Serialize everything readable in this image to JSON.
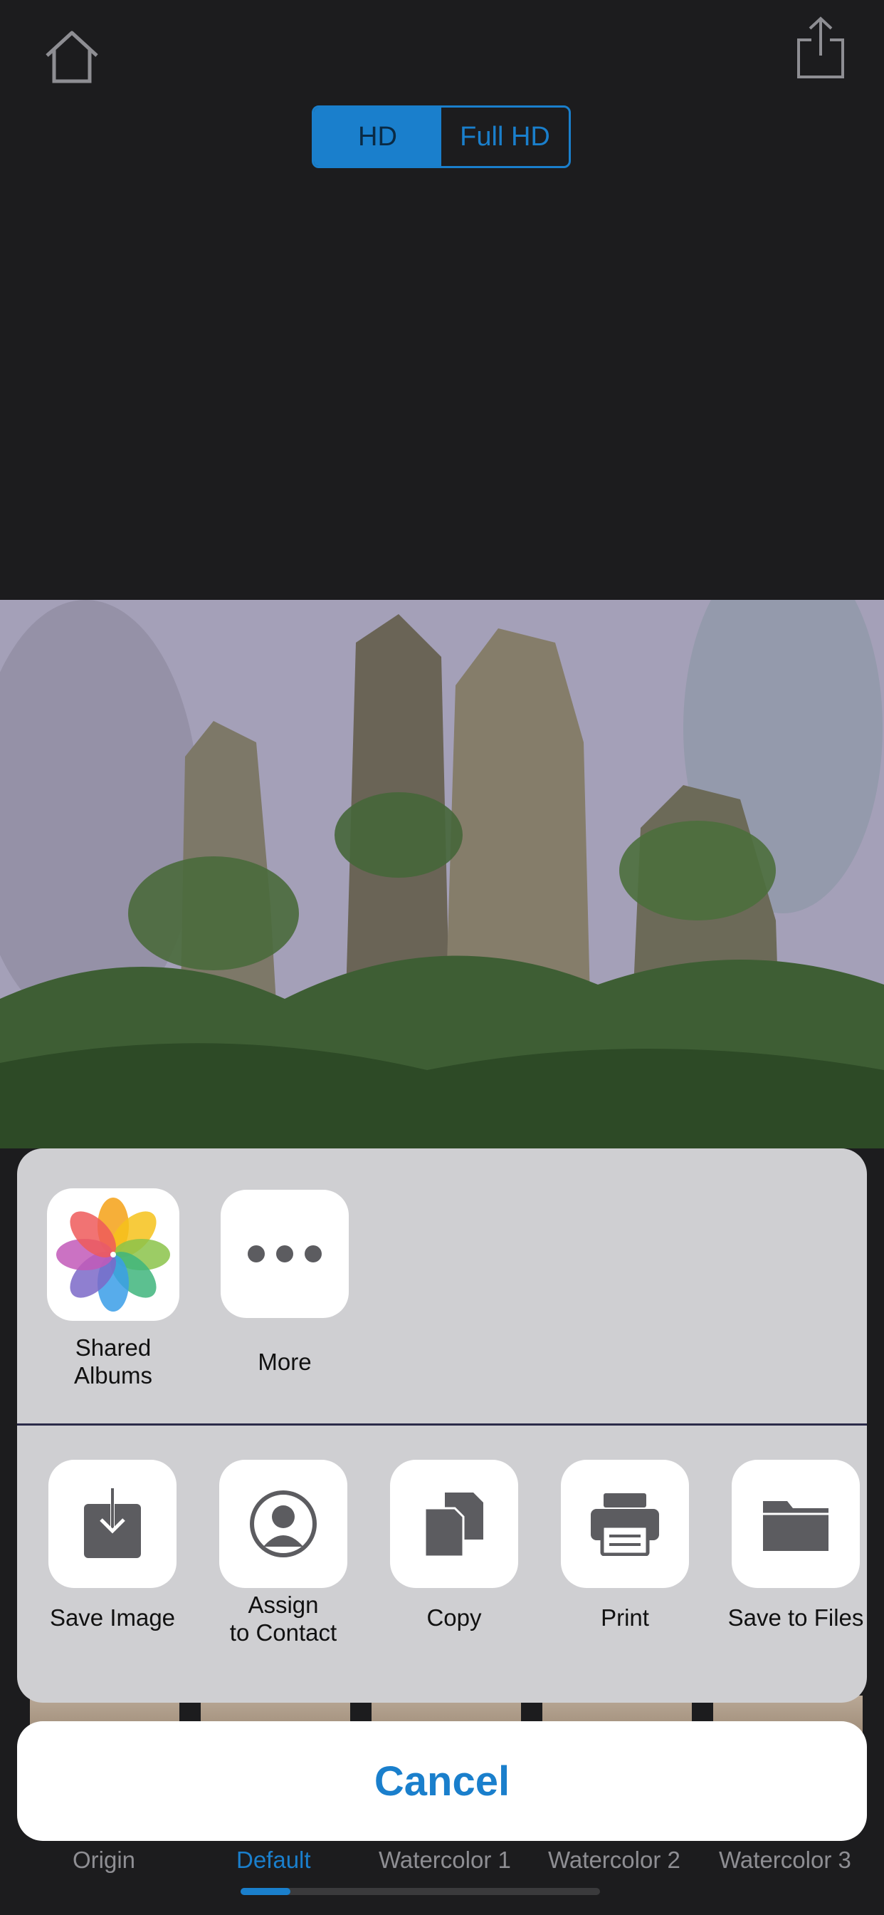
{
  "toolbar": {
    "home_icon": "home-icon",
    "share_icon": "share-icon"
  },
  "quality": {
    "options": [
      "HD",
      "Full HD"
    ],
    "selected": "HD"
  },
  "filters": [
    "Origin",
    "Default",
    "Watercolor 1",
    "Watercolor 2",
    "Watercolor 3"
  ],
  "filters_selected": "Default",
  "share_sheet": {
    "apps": [
      {
        "label": "Shared\nAlbums",
        "icon": "photos-icon"
      },
      {
        "label": "More",
        "icon": "more-icon"
      }
    ],
    "actions": [
      {
        "label": "Save Image",
        "icon": "save-image-icon"
      },
      {
        "label": "Assign\nto Contact",
        "icon": "contact-icon"
      },
      {
        "label": "Copy",
        "icon": "copy-icon"
      },
      {
        "label": "Print",
        "icon": "print-icon"
      },
      {
        "label": "Save to Files",
        "icon": "folder-icon"
      }
    ],
    "cancel_label": "Cancel"
  },
  "colors": {
    "accent": "#1a7fcc",
    "background": "#1c1c1e",
    "sheet": "#cfcfd2"
  }
}
